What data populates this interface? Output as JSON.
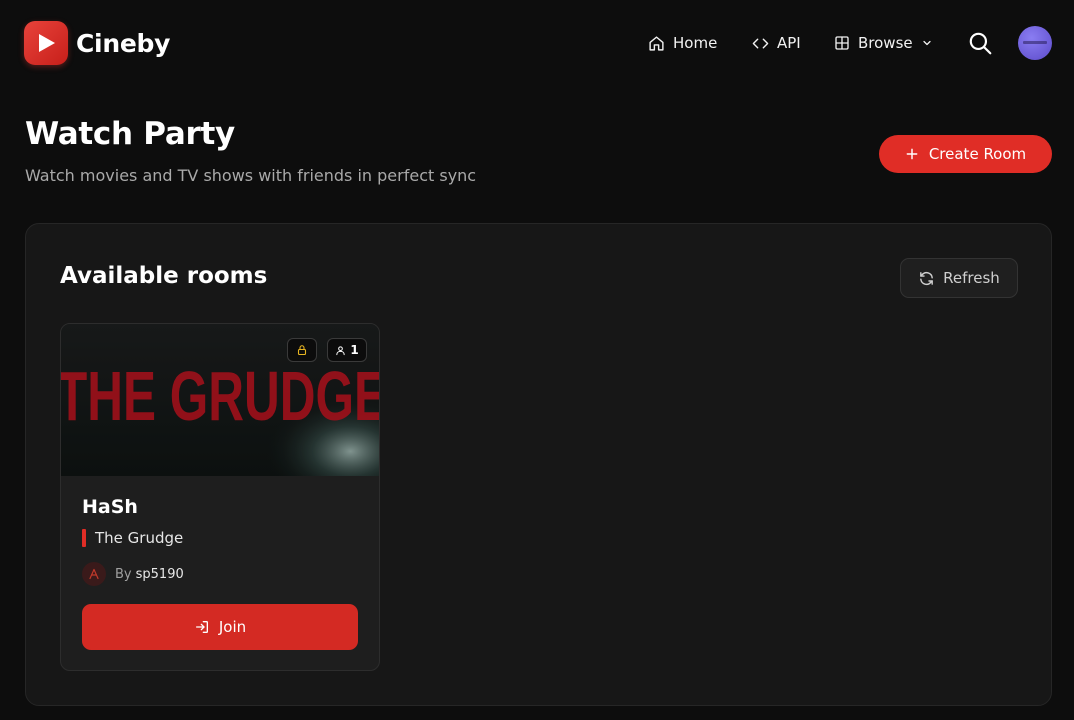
{
  "header": {
    "logo_text": "Cineby",
    "nav": [
      {
        "label": "Home",
        "icon": "home-icon"
      },
      {
        "label": "API",
        "icon": "code-icon"
      },
      {
        "label": "Browse",
        "icon": "grid-icon"
      }
    ]
  },
  "page": {
    "title": "Watch Party",
    "subtitle": "Watch movies and TV shows with friends in perfect sync",
    "create_room_label": "Create Room"
  },
  "rooms_panel": {
    "title": "Available rooms",
    "refresh_label": "Refresh",
    "rooms": [
      {
        "name": "HaSh",
        "movie": "The Grudge",
        "poster_text": "THE GRUDGE",
        "locked": true,
        "participants": "1",
        "host_prefix": "By",
        "host": "sp5190",
        "join_label": "Join"
      }
    ]
  },
  "colors": {
    "background": "#0d0d0d",
    "accent": "#e02d26",
    "panel": "#171717",
    "card": "#1e1e1e",
    "lock_icon": "#e6b422",
    "avatar": "#6a5ad6"
  }
}
